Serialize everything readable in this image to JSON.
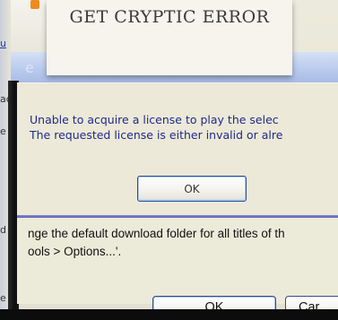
{
  "caption": {
    "title": "GET CRYPTIC ERROR"
  },
  "background_window": {
    "title_fragment": "e",
    "side_labels": [
      "u",
      "ac",
      "e",
      "d",
      "e"
    ]
  },
  "error_dialog": {
    "message_lines": [
      "Unable to acquire a license to play the selec",
      "The requested license is either invalid or alre"
    ],
    "ok_label": "OK"
  },
  "info_strip": {
    "lines": [
      "nge the default download folder for all titles of th",
      "ools > Options...'."
    ]
  },
  "bottom_buttons": {
    "ok_label": "OK",
    "cancel_label": "Car"
  },
  "colors": {
    "dialog_bg": "#ece9d8",
    "message_text": "#1e2a8a",
    "button_border": "#244c9c",
    "divider": "#5b67b8"
  }
}
